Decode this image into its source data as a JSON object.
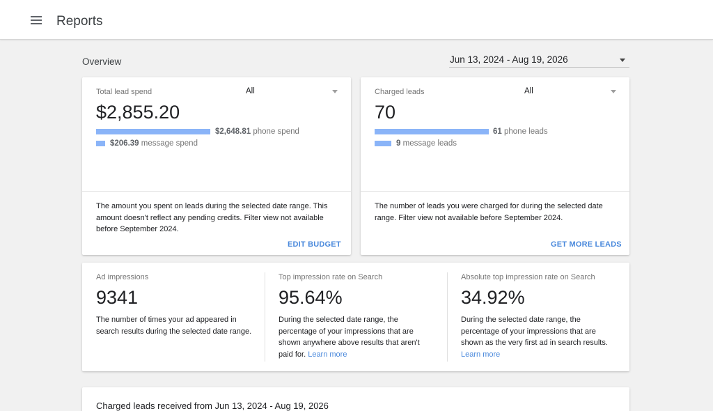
{
  "header": {
    "title": "Reports",
    "menu_icon": "hamburger-menu-icon"
  },
  "overview": {
    "label": "Overview",
    "date_range": "Jun 13, 2024 - Aug 19, 2026"
  },
  "lead_spend": {
    "label": "Total lead spend",
    "filter": "All",
    "value": "$2,855.20",
    "phone_amount": "$2,648.81",
    "phone_label": "phone spend",
    "phone_share": 0.928,
    "message_amount": "$206.39",
    "message_label": "message spend",
    "message_share": 0.072,
    "description": "The amount you spent on leads during the selected date range. This amount doesn't reflect any pending credits. Filter view not available before September 2024.",
    "action": "EDIT BUDGET"
  },
  "charged_leads": {
    "label": "Charged leads",
    "filter": "All",
    "value": "70",
    "phone_count": "61",
    "phone_label": "phone leads",
    "phone_share": 0.871,
    "message_count": "9",
    "message_label": "message leads",
    "message_share": 0.129,
    "description": "The number of leads you were charged for during the selected date range. Filter view not available before September 2024.",
    "action": "GET MORE LEADS"
  },
  "impressions": {
    "ad_impressions": {
      "label": "Ad impressions",
      "value": "9341",
      "description": "The number of times your ad appeared in search results during the selected date range."
    },
    "top_rate": {
      "label": "Top impression rate on Search",
      "value": "95.64%",
      "description": "During the selected date range, the percentage of your impressions that are shown anywhere above results that aren't paid for.",
      "link": "Learn more"
    },
    "absolute_top_rate": {
      "label": "Absolute top impression rate on Search",
      "value": "34.92%",
      "description": "During the selected date range, the percentage of your impressions that are shown as the very first ad in search results.",
      "link": "Learn more"
    }
  },
  "charged_leads_received": {
    "title": "Charged leads received from Jun 13, 2024 - Aug 19, 2026"
  },
  "colors": {
    "accent_blue": "#4a89dc",
    "bar_blue": "#8ab4f8",
    "background": "#f1f1f1"
  }
}
